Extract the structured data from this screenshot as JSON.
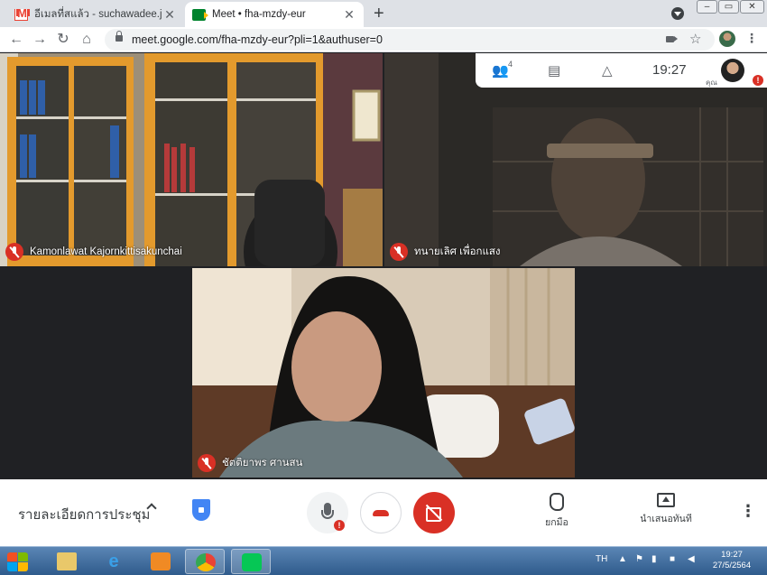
{
  "browser": {
    "tabs": [
      {
        "title": "อีเมลที่สแล้ว - suchawadee.ju@spru",
        "active": false
      },
      {
        "title": "Meet • fha-mzdy-eur",
        "active": true
      }
    ],
    "url": "meet.google.com/fha-mzdy-eur?pli=1&authuser=0"
  },
  "meet": {
    "time": "19:27",
    "people_count": "4",
    "you_label": "คุณ",
    "participants": [
      {
        "name": "Kamonlawat Kajornkittisakunchai",
        "muted": true
      },
      {
        "name": "ทนายเลิศ เพื่อกแสง",
        "muted": true
      },
      {
        "name": "ชัตติยาพร ศานสน",
        "muted": true
      }
    ],
    "controls": {
      "meeting_details": "รายละเอียดการประชุม",
      "raise_hand": "ยกมือ",
      "present_now": "นำเสนอทันที"
    }
  },
  "taskbar": {
    "lang": "TH",
    "time": "19:27",
    "date": "27/5/2564"
  },
  "colors": {
    "danger": "#d93025",
    "meet_bg": "#202124",
    "shield": "#4285f4"
  }
}
